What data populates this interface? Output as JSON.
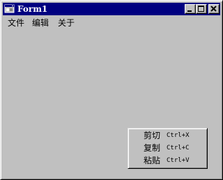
{
  "window": {
    "title": "Form1",
    "icon": "form-app-icon",
    "controls": {
      "minimize": "minimize-icon",
      "maximize": "maximize-icon",
      "close": "close-icon"
    },
    "colors": {
      "titlebar": "#000080",
      "face": "#c0c0c0"
    }
  },
  "menubar": {
    "items": [
      {
        "label": "文件"
      },
      {
        "label": "编辑"
      },
      {
        "label": "关于"
      }
    ]
  },
  "context_menu": {
    "items": [
      {
        "label": "剪切",
        "shortcut": "Ctrl+X"
      },
      {
        "label": "复制",
        "shortcut": "Ctrl+C"
      },
      {
        "label": "粘贴",
        "shortcut": "Ctrl+V"
      }
    ]
  }
}
